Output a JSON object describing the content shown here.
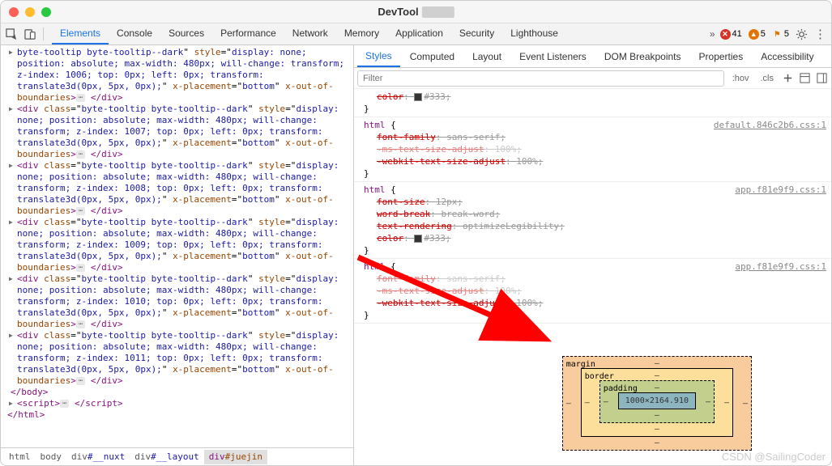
{
  "window": {
    "title": "DevTool"
  },
  "toolbar": {
    "tabs": [
      "Elements",
      "Console",
      "Sources",
      "Performance",
      "Network",
      "Memory",
      "Application",
      "Security",
      "Lighthouse"
    ],
    "active": 0,
    "errors": "41",
    "warnings": "5",
    "flags": "5"
  },
  "dom": {
    "nodes": [
      {
        "zindex": "1006"
      },
      {
        "zindex": "1007"
      },
      {
        "zindex": "1008"
      },
      {
        "zindex": "1009"
      },
      {
        "zindex": "1010"
      },
      {
        "zindex": "1011"
      }
    ],
    "div_class": "byte-tooltip byte-tooltip--dark",
    "style_prefix": "display: none; position: absolute; max-width: 480px; will-change: transform; z-index: ",
    "style_suffix": "; top: 0px; left: 0px; transform: translate3d(0px, 5px, 0px);",
    "x_placement": "bottom",
    "x_out": "x-out-of-boundaries",
    "close_body": "</body>",
    "script_open": "<script>",
    "script_close": "</script>",
    "close_html": "</html>"
  },
  "crumbs": [
    {
      "tag": "html",
      "id": ""
    },
    {
      "tag": "body",
      "id": ""
    },
    {
      "tag": "div",
      "id": "#__nuxt"
    },
    {
      "tag": "div",
      "id": "#__layout"
    },
    {
      "tag": "div",
      "id": "#juejin"
    }
  ],
  "subtabs": [
    "Styles",
    "Computed",
    "Layout",
    "Event Listeners",
    "DOM Breakpoints",
    "Properties",
    "Accessibility"
  ],
  "filter": {
    "placeholder": "Filter",
    "hov": ":hov",
    "cls": ".cls"
  },
  "rules": [
    {
      "src": "",
      "selector": "",
      "props": [
        {
          "n": "color",
          "v": "#333",
          "swatch": "#333",
          "strike": true
        }
      ],
      "close": true,
      "partial": true
    },
    {
      "src": "default.846c2b6.css:1",
      "selector": "html",
      "props": [
        {
          "n": "font-family",
          "v": "sans-serif",
          "strike": true
        },
        {
          "n": "-ms-text-size-adjust",
          "v": "100%",
          "strike": true,
          "faded": true
        },
        {
          "n": "-webkit-text-size-adjust",
          "v": "100%",
          "strike": true
        }
      ],
      "close": true
    },
    {
      "src": "app.f81e9f9.css:1",
      "selector": "html",
      "props": [
        {
          "n": "font-size",
          "v": "12px",
          "strike": true
        },
        {
          "n": "word-break",
          "v": "break-word",
          "strike": true
        },
        {
          "n": "text-rendering",
          "v": "optimizeLegibility",
          "strike": true
        },
        {
          "n": "color",
          "v": "#333",
          "swatch": "#333",
          "strike": true
        }
      ],
      "close": true
    },
    {
      "src": "app.f81e9f9.css:1",
      "selector": "html",
      "props": [
        {
          "n": "font-family",
          "v": "sans-serif",
          "strike": true,
          "faded": true
        },
        {
          "n": "-ms-text-size-adjust",
          "v": "100%",
          "strike": true,
          "faded": true
        },
        {
          "n": "-webkit-text-size-adjust",
          "v": "100%",
          "strike": true
        }
      ],
      "close": true
    }
  ],
  "boxmodel": {
    "margin": {
      "label": "margin",
      "t": "–",
      "r": "–",
      "b": "–",
      "l": "–"
    },
    "border": {
      "label": "border",
      "t": "–",
      "r": "–",
      "b": "–",
      "l": "–"
    },
    "padding": {
      "label": "padding",
      "t": "–",
      "r": "–",
      "b": "–",
      "l": "–"
    },
    "content": "1000×2164.910"
  },
  "watermark": "CSDN @SailingCoder"
}
